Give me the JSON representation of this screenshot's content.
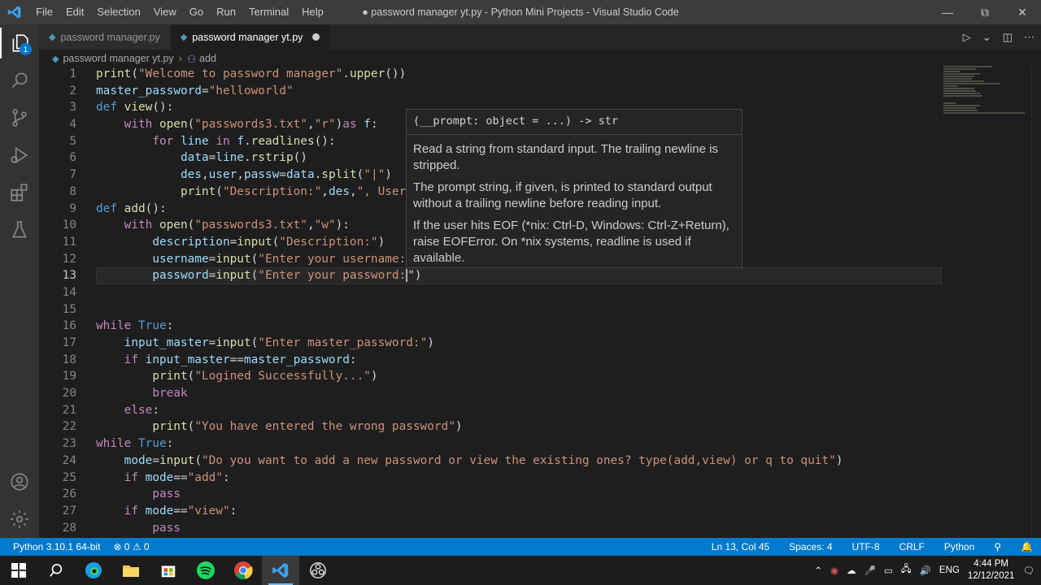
{
  "titlebar": {
    "menu": [
      "File",
      "Edit",
      "Selection",
      "View",
      "Go",
      "Run",
      "Terminal",
      "Help"
    ],
    "title": "● password manager yt.py - Python Mini Projects - Visual Studio Code"
  },
  "activity": {
    "explorer_badge": "1"
  },
  "tabs": [
    {
      "label": "password manager.py"
    },
    {
      "label": "password manager yt.py"
    }
  ],
  "breadcrumb": {
    "file": "password manager yt.py",
    "symbol": "add"
  },
  "hover": {
    "signature": "(__prompt: object = ...) -> str",
    "p1": "Read a string from standard input. The trailing newline is stripped.",
    "p2": "The prompt string, if given, is printed to standard output without a trailing newline before reading input.",
    "p3": "If the user hits EOF (*nix: Ctrl-D, Windows: Ctrl-Z+Return), raise EOFError. On *nix systems, readline is used if available."
  },
  "status": {
    "interpreter": "Python 3.10.1 64-bit",
    "problems": "⊗ 0 ⚠ 0",
    "position": "Ln 13, Col 45",
    "spaces": "Spaces: 4",
    "encoding": "UTF-8",
    "eol": "CRLF",
    "language": "Python"
  },
  "taskbar": {
    "lang": "ENG",
    "time": "4:44 PM",
    "date": "12/12/2021"
  },
  "colors": {
    "accent": "#007acc",
    "keyword": "#c586c0",
    "string": "#ce9178",
    "function": "#dcdcaa"
  }
}
